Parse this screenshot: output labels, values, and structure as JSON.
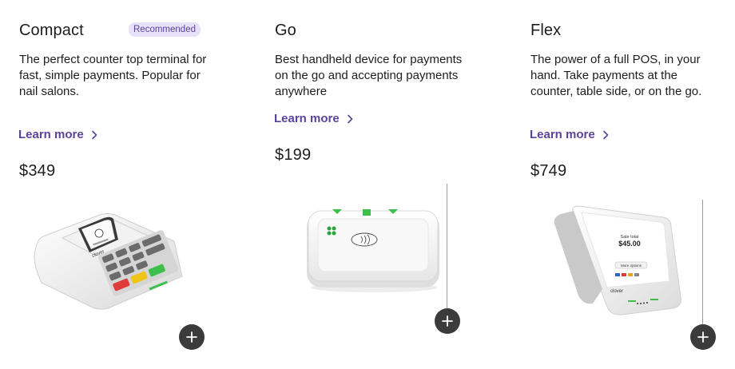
{
  "products": [
    {
      "name": "Compact",
      "badge": "Recommended",
      "description": "The perfect counter top terminal for fast, simple payments. Popular for nail salons.",
      "learn_more": "Learn more",
      "price": "$349",
      "brand_label": "clover"
    },
    {
      "name": "Go",
      "description": "Best handheld device for payments on the go and accepting payments anywhere",
      "learn_more": "Learn more",
      "price": "$199"
    },
    {
      "name": "Flex",
      "description": "The power of a full POS, in your hand. Take payments at the counter, table side, or on the go.",
      "learn_more": "Learn more",
      "price": "$749",
      "brand_label": "clover",
      "screen": {
        "line1": "Sale total",
        "amount": "$45.00",
        "button": "More options"
      }
    }
  ],
  "colors": {
    "accent": "#5b4399",
    "badge_bg": "#e8e1fa",
    "button_bg": "#3b3b3b",
    "clover_green": "#3cbf4b"
  },
  "icons": {
    "learn_more": "chevron-right-icon",
    "add": "plus-icon"
  }
}
